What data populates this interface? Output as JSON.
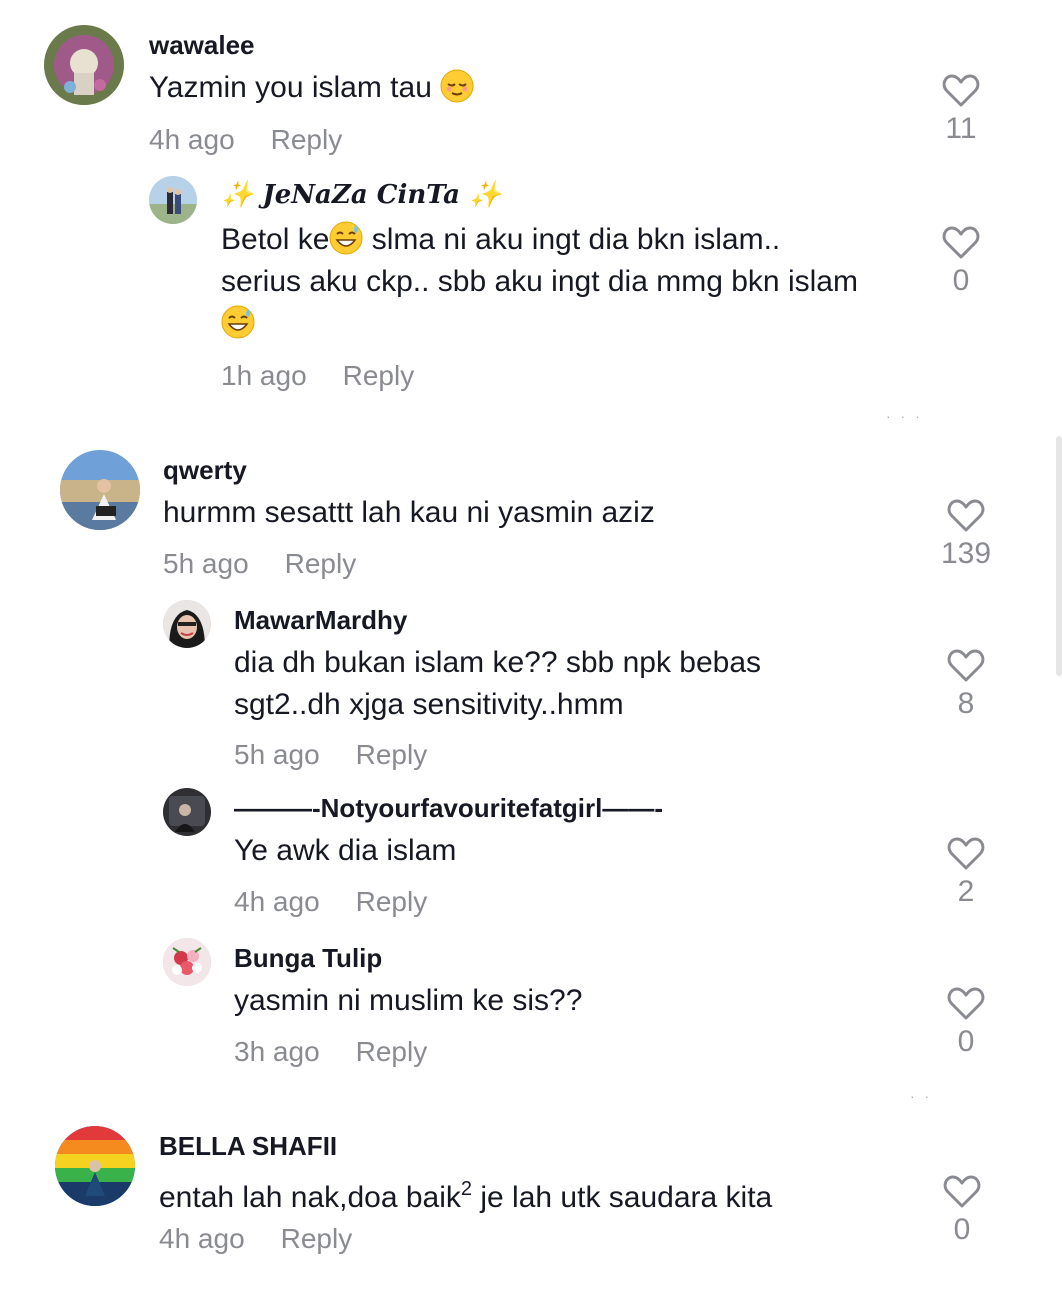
{
  "comments": [
    {
      "username": "wawalee",
      "text": "Yazmin you islam tau",
      "emoji": "relieved-face",
      "time": "4h ago",
      "reply": "Reply",
      "likes": "11",
      "replies": [
        {
          "username_prefix": "✨",
          "username": "JeNaZa CinTa",
          "username_suffix": "✨",
          "text_parts": [
            "Betol ke",
            " slma ni aku ingt dia bkn islam.. serius aku ckp.. sbb aku ingt dia mmg bkn islam"
          ],
          "emoji": "grinning-sweat-face",
          "time": "1h ago",
          "reply": "Reply",
          "likes": "0"
        }
      ]
    },
    {
      "username": "qwerty",
      "text": "hurmm sesattt lah kau ni yasmin aziz",
      "time": "5h ago",
      "reply": "Reply",
      "likes": "139",
      "replies": [
        {
          "username": "MawarMardhy",
          "text": "dia dh bukan islam ke?? sbb npk bebas sgt2..dh xjga sensitivity..hmm",
          "time": "5h ago",
          "reply": "Reply",
          "likes": "8"
        },
        {
          "username": "———-Notyourfavouritefatgirl——-",
          "text": "Ye awk dia islam",
          "time": "4h ago",
          "reply": "Reply",
          "likes": "2"
        },
        {
          "username": "Bunga Tulip",
          "text": "yasmin ni muslim ke sis??",
          "time": "3h ago",
          "reply": "Reply",
          "likes": "0"
        }
      ]
    },
    {
      "username": "BELLA SHAFII",
      "text_pre": "entah lah nak,doa baik",
      "text_sup": "2",
      "text_post": " je lah utk saudara kita",
      "time": "4h ago",
      "reply": "Reply",
      "likes": "0"
    }
  ],
  "colors": {
    "text": "#161823",
    "muted": "#8a8b91",
    "background": "#ffffff"
  },
  "icons": {
    "like": "heart-outline-icon"
  }
}
